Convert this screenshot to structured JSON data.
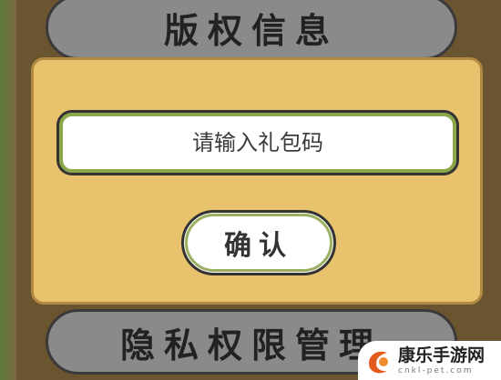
{
  "background_menu": {
    "top_button_label": "版权信息",
    "bottom_button_label": "隐私权限管理"
  },
  "gift_dialog": {
    "code_input": {
      "placeholder": "请输入礼包码",
      "value": ""
    },
    "confirm_label": "确认"
  },
  "watermark": {
    "title": "康乐手游网",
    "url": "cnkl-pet.com"
  },
  "colors": {
    "dialog_bg": "#e9c26e",
    "input_border": "#8aa84a",
    "menu_button_bg": "#8a8a8a"
  }
}
